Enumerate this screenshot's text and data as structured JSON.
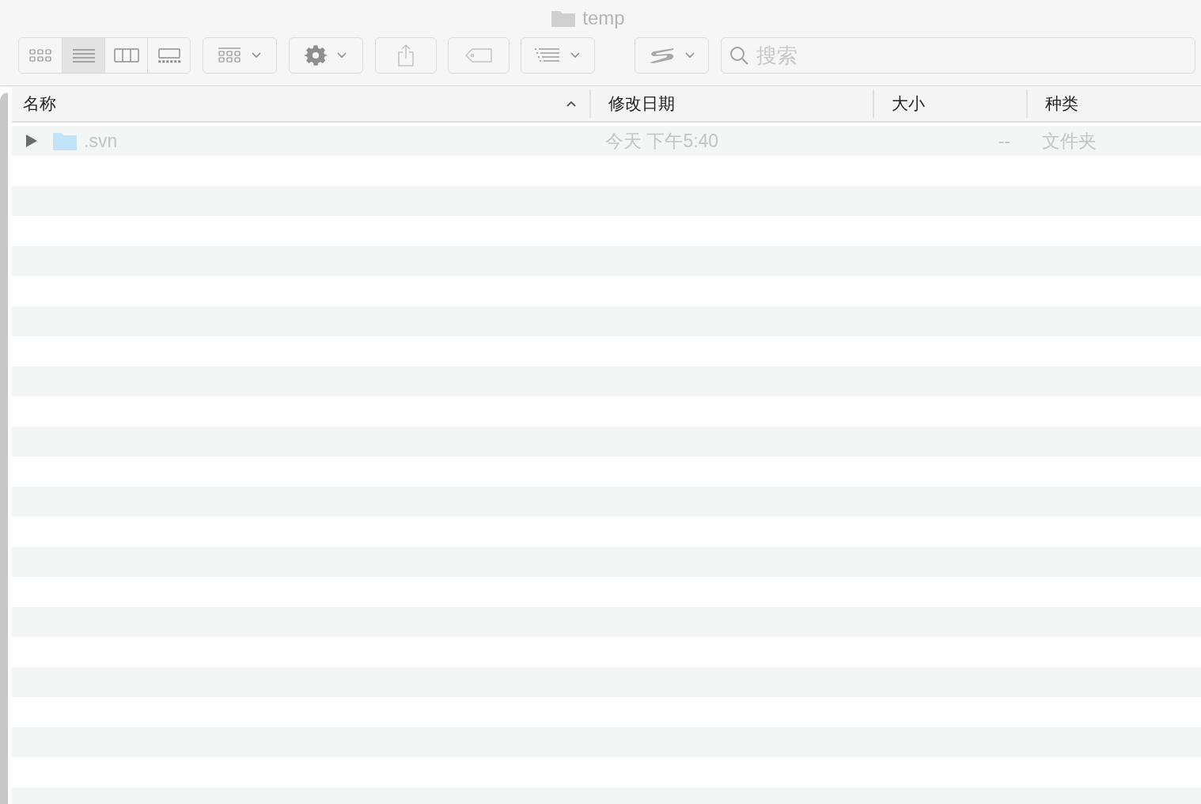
{
  "window": {
    "title": "temp"
  },
  "toolbar": {
    "view_buttons": [
      {
        "kind": "icons",
        "selected": false
      },
      {
        "kind": "list",
        "selected": true
      },
      {
        "kind": "columns",
        "selected": false
      },
      {
        "kind": "gallery",
        "selected": false
      }
    ]
  },
  "search": {
    "placeholder": "搜索"
  },
  "table": {
    "columns": [
      {
        "label": "名称",
        "sorted": true
      },
      {
        "label": "修改日期",
        "sorted": false
      },
      {
        "label": "大小",
        "sorted": false
      },
      {
        "label": "种类",
        "sorted": false
      }
    ],
    "rows": [
      {
        "name": ".svn",
        "modified": "今天 下午5:40",
        "size": "--",
        "kind": "文件夹",
        "expanded": false
      }
    ]
  }
}
